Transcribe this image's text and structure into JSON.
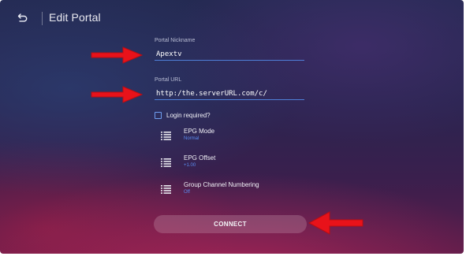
{
  "header": {
    "title": "Edit Portal",
    "back_icon": "back-arrow-icon"
  },
  "form": {
    "nickname": {
      "label": "Portal Nickname",
      "value": "Apextv"
    },
    "url": {
      "label": "Portal URL",
      "value": "http:/the.serverURL.com/c/"
    },
    "login": {
      "label": "Login required?",
      "checked": false
    }
  },
  "settings": [
    {
      "name": "EPG Mode",
      "value": "Normal",
      "icon": "list-icon"
    },
    {
      "name": "EPG Offset",
      "value": "+1.00",
      "icon": "list-icon"
    },
    {
      "name": "Group Channel Numbering",
      "value": "Off",
      "icon": "list-icon"
    }
  ],
  "connect_label": "CONNECT",
  "colors": {
    "accent": "#5b8df0",
    "underline": "#4f7fd8",
    "annotation_arrow": "#e8121a"
  }
}
